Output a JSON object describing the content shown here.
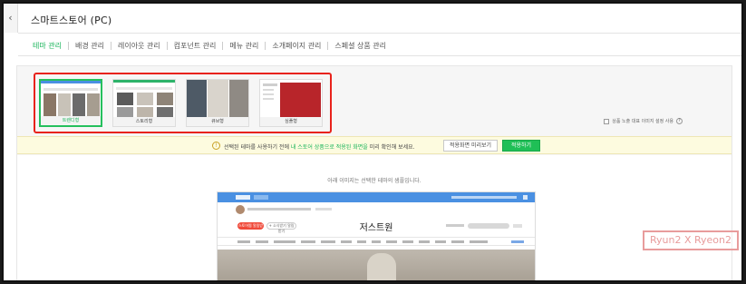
{
  "window": {
    "title": "스마트스토어 (PC)",
    "back_glyph": "‹"
  },
  "tabs": [
    {
      "label": "테마 관리",
      "active": true
    },
    {
      "label": "배경 관리",
      "active": false
    },
    {
      "label": "레이아웃 관리",
      "active": false
    },
    {
      "label": "컴포넌트 관리",
      "active": false
    },
    {
      "label": "메뉴 관리",
      "active": false
    },
    {
      "label": "소개페이지 관리",
      "active": false
    },
    {
      "label": "스페셜 상품 관리",
      "active": false
    }
  ],
  "themes": [
    {
      "label": "트렌디형",
      "selected": true
    },
    {
      "label": "스토리형",
      "selected": false
    },
    {
      "label": "큐브형",
      "selected": false
    },
    {
      "label": "심플형",
      "selected": false
    }
  ],
  "option": {
    "label": "상품 노출 대표 이미지 설정 사용",
    "help_glyph": "?"
  },
  "notice": {
    "icon_glyph": "!",
    "text_before": "선택된 테마를 사용하기 전에 ",
    "text_emphasis": "내 스토어 상품으로 적용된 화면을",
    "text_after": " 미리 확인해 보세요.",
    "preview_button": "적용화면 미리보기",
    "apply_button": "적용하기"
  },
  "preview": {
    "caption": "아래 이미지는 선택한 테마의 샘플입니다.",
    "shop_name": "저스트원",
    "pill_primary": "스토어찜 알림받기",
    "pill_secondary": "+ 소식받기 알림받기"
  },
  "watermark": "Ryun2 X Ryeon2",
  "colors": {
    "accent": "#19b45a",
    "apply_button": "#1fbf56",
    "highlight_box": "#e8221b",
    "shop_header": "#4a90e2"
  }
}
